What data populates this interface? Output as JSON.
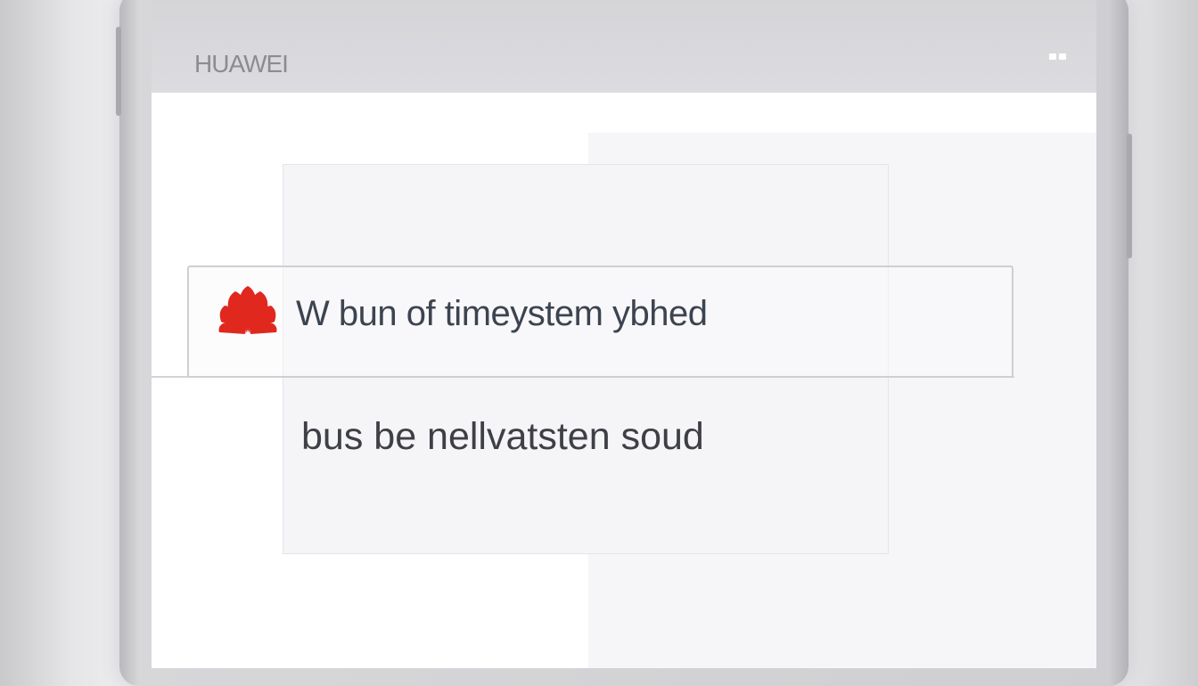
{
  "header": {
    "brand": "HUAWEI"
  },
  "card": {
    "title": "W bun of timeystem ybhed",
    "subtitle": "bus be nellvatsten soud"
  },
  "icons": {
    "logo": "huawei-petal-logo",
    "menu": "more-options-icon"
  },
  "colors": {
    "brand_red": "#e0281e",
    "top_bar": "#d8d8dc"
  }
}
